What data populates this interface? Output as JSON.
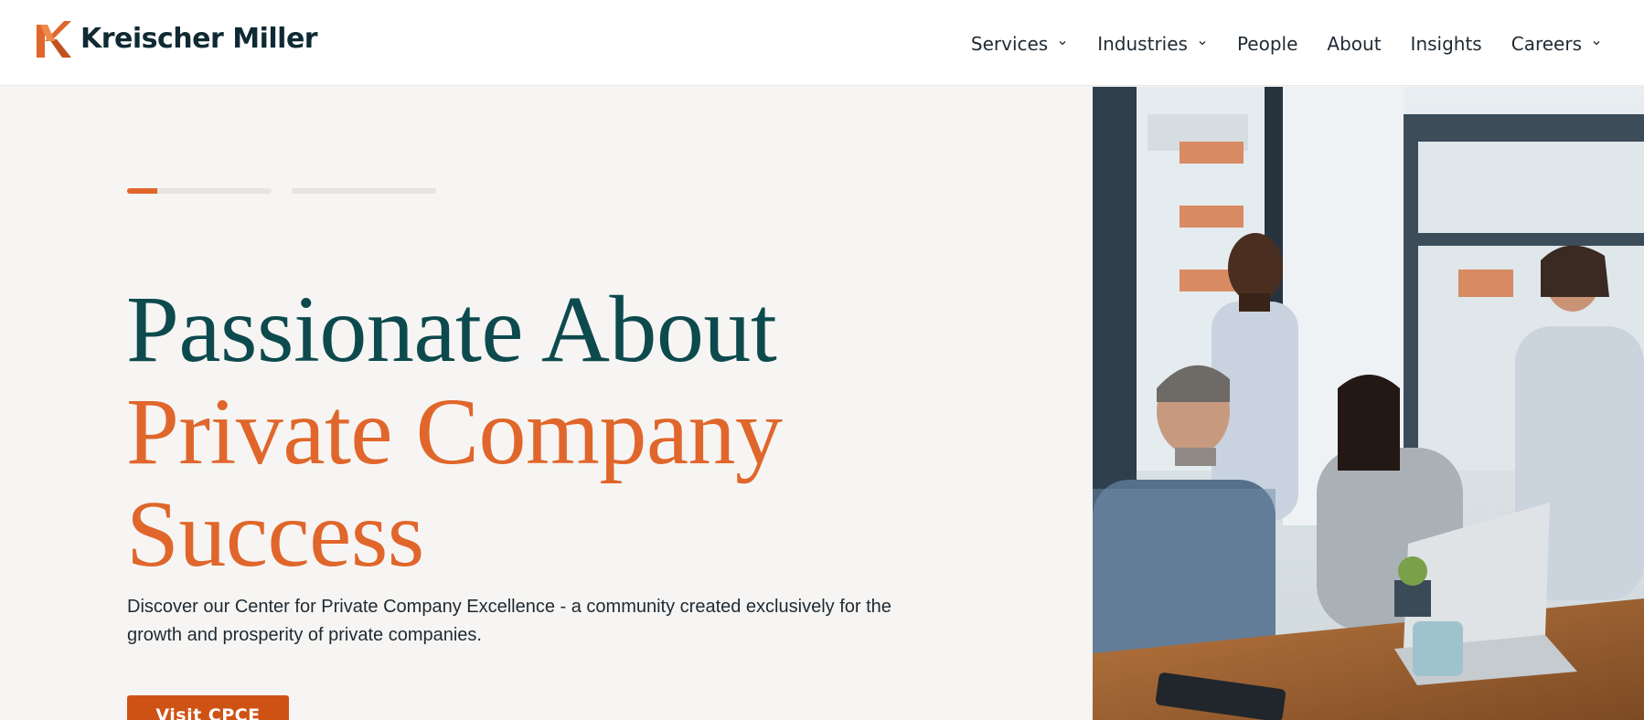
{
  "brand": {
    "name": "Kreischer Miller",
    "accent": "#e0662b",
    "dark": "#0d4a4d"
  },
  "nav": {
    "items": [
      {
        "label": "Services",
        "dropdown": true
      },
      {
        "label": "Industries",
        "dropdown": true
      },
      {
        "label": "People",
        "dropdown": false
      },
      {
        "label": "About",
        "dropdown": false
      },
      {
        "label": "Insights",
        "dropdown": false
      },
      {
        "label": "Careers",
        "dropdown": true
      }
    ]
  },
  "hero": {
    "headline_line1": "Passionate About",
    "headline_line2": "Private Company",
    "headline_line3": "Success",
    "description": "Discover our Center for Private Company Excellence - a community created exclusively for the growth and prosperity of private companies.",
    "cta_label": "Visit CPCE",
    "slider": {
      "slides": 2,
      "active_index": 0,
      "active_progress": 0.21
    }
  }
}
